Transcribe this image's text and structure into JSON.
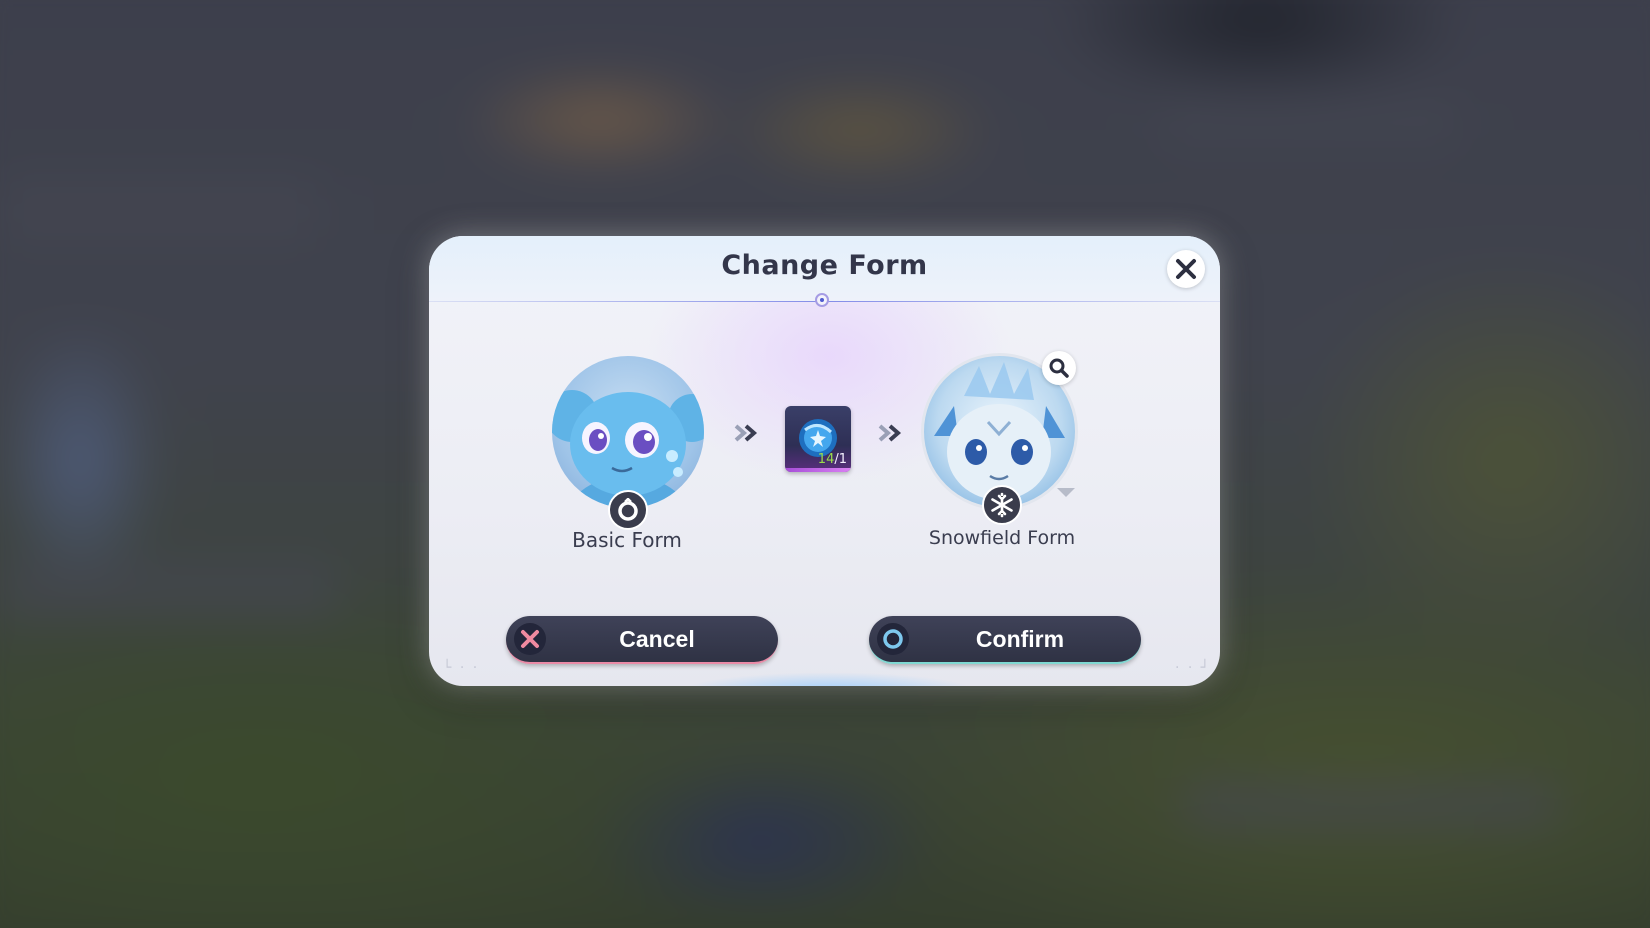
{
  "dialog": {
    "title": "Change Form",
    "close_icon": "close-icon"
  },
  "from_form": {
    "label": "Basic Form",
    "badge_icon": "ring-icon"
  },
  "material": {
    "icon": "evolution-orb-icon",
    "have": "14",
    "need": "/1"
  },
  "to_form": {
    "label": "Snowfield Form",
    "badge_icon": "snowflake-icon",
    "preview_icon": "magnify-icon"
  },
  "buttons": {
    "cancel_label": "Cancel",
    "confirm_label": "Confirm"
  },
  "colors": {
    "cancel_accent": "#e98aa6",
    "confirm_accent": "#7fd8d2",
    "title_color": "#33364a"
  }
}
